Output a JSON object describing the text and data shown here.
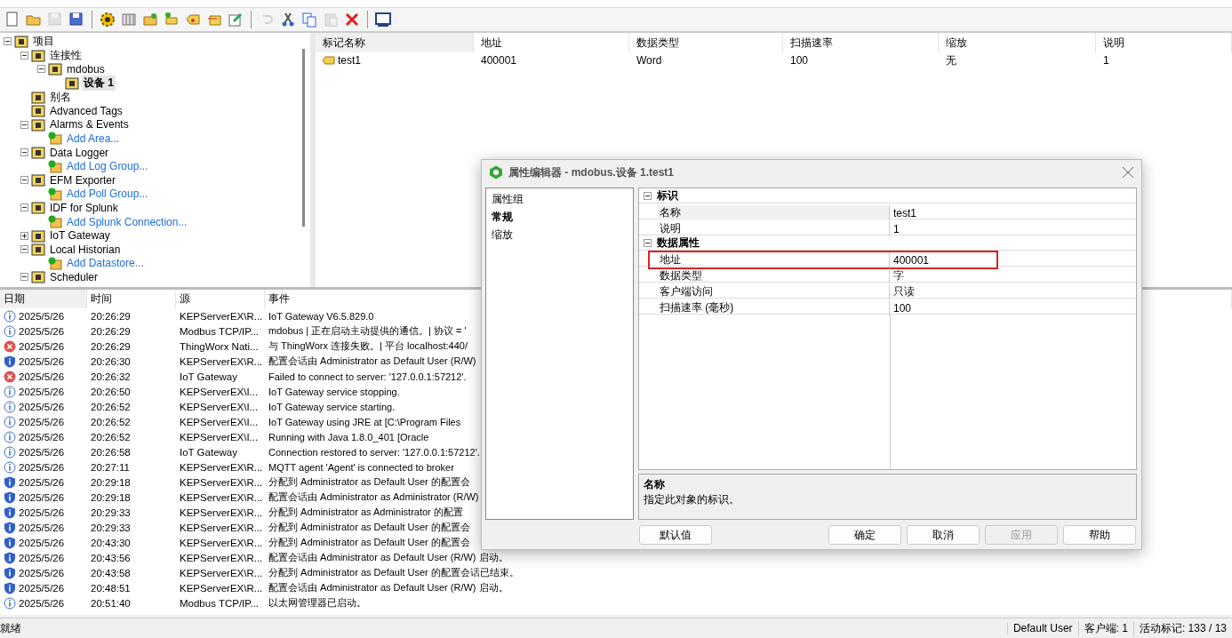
{
  "toolbar": {
    "buttons": [
      {
        "kind": "new"
      },
      {
        "kind": "open"
      },
      {
        "kind": "save",
        "disabled": true
      },
      {
        "kind": "saveas"
      },
      {
        "kind": "sep"
      },
      {
        "kind": "gear"
      },
      {
        "kind": "grid"
      },
      {
        "kind": "folderadd"
      },
      {
        "kind": "tagadd"
      },
      {
        "kind": "tag"
      },
      {
        "kind": "tags"
      },
      {
        "kind": "edit"
      },
      {
        "kind": "sep"
      },
      {
        "kind": "undo",
        "disabled": true
      },
      {
        "kind": "cut"
      },
      {
        "kind": "copy"
      },
      {
        "kind": "paste",
        "disabled": true
      },
      {
        "kind": "delete"
      },
      {
        "kind": "sep"
      },
      {
        "kind": "monitor"
      }
    ]
  },
  "tree": [
    {
      "label": "项目",
      "kind": "node",
      "expanded": true,
      "selected": false,
      "children": [
        {
          "label": "连接性",
          "kind": "node",
          "expanded": true,
          "selected": false,
          "children": [
            {
              "label": "mdobus",
              "kind": "node",
              "expanded": true,
              "selected": false,
              "children": [
                {
                  "label": "设备 1",
                  "kind": "node",
                  "selected": true
                }
              ]
            }
          ]
        },
        {
          "label": "别名",
          "kind": "node",
          "selected": false
        },
        {
          "label": "Advanced Tags",
          "kind": "node",
          "selected": false
        },
        {
          "label": "Alarms & Events",
          "kind": "node",
          "expanded": true,
          "selected": false,
          "children": [
            {
              "label": "Add Area...",
              "kind": "action",
              "selected": false
            }
          ]
        },
        {
          "label": "Data Logger",
          "kind": "node",
          "expanded": true,
          "selected": false,
          "children": [
            {
              "label": "Add Log Group...",
              "kind": "action",
              "selected": false
            }
          ]
        },
        {
          "label": "EFM Exporter",
          "kind": "node",
          "expanded": true,
          "selected": false,
          "children": [
            {
              "label": "Add Poll Group...",
              "kind": "action",
              "selected": false
            }
          ]
        },
        {
          "label": "IDF for Splunk",
          "kind": "node",
          "expanded": true,
          "selected": false,
          "children": [
            {
              "label": "Add Splunk Connection...",
              "kind": "action",
              "selected": false
            }
          ]
        },
        {
          "label": "IoT Gateway",
          "kind": "node",
          "expanded": false,
          "selected": false
        },
        {
          "label": "Local Historian",
          "kind": "node",
          "expanded": true,
          "selected": false,
          "children": [
            {
              "label": "Add Datastore...",
              "kind": "action",
              "selected": false
            }
          ]
        },
        {
          "label": "Scheduler",
          "kind": "node",
          "expanded": true,
          "selected": false
        }
      ]
    }
  ],
  "tag_table": {
    "columns": [
      "标记名称",
      "地址",
      "数据类型",
      "扫描速率",
      "缩放",
      "说明"
    ],
    "rows": [
      [
        "test1",
        "400001",
        "Word",
        "100",
        "无",
        "1"
      ]
    ]
  },
  "event_log": {
    "columns": [
      "日期",
      "时间",
      "源",
      "事件"
    ],
    "rows": [
      {
        "kind": "info",
        "date": "2025/5/26",
        "time": "20:26:29",
        "source": "KEPServerEX\\R...",
        "event": "IoT Gateway V6.5.829.0"
      },
      {
        "kind": "info",
        "date": "2025/5/26",
        "time": "20:26:29",
        "source": "Modbus TCP/IP...",
        "event": "mdobus | 正在启动主动提供的通信。| 协议 = '"
      },
      {
        "kind": "error",
        "date": "2025/5/26",
        "time": "20:26:29",
        "source": "ThingWorx Nati...",
        "event": "与 ThingWorx 连接失败。| 平台 localhost:440/"
      },
      {
        "kind": "security",
        "date": "2025/5/26",
        "time": "20:26:30",
        "source": "KEPServerEX\\R...",
        "event": "配置会话由 Administrator as Default User (R/W)"
      },
      {
        "kind": "error",
        "date": "2025/5/26",
        "time": "20:26:32",
        "source": "IoT Gateway",
        "event": "Failed to connect to server: '127.0.0.1:57212'."
      },
      {
        "kind": "info",
        "date": "2025/5/26",
        "time": "20:26:50",
        "source": "KEPServerEX\\I...",
        "event": "IoT Gateway service stopping."
      },
      {
        "kind": "info",
        "date": "2025/5/26",
        "time": "20:26:52",
        "source": "KEPServerEX\\I...",
        "event": "IoT Gateway service starting."
      },
      {
        "kind": "info",
        "date": "2025/5/26",
        "time": "20:26:52",
        "source": "KEPServerEX\\I...",
        "event": "IoT Gateway using JRE at [C:\\Program Files"
      },
      {
        "kind": "info",
        "date": "2025/5/26",
        "time": "20:26:52",
        "source": "KEPServerEX\\I...",
        "event": "Running with Java 1.8.0_401 [Oracle"
      },
      {
        "kind": "info",
        "date": "2025/5/26",
        "time": "20:26:58",
        "source": "IoT Gateway",
        "event": "Connection restored to server: '127.0.0.1:57212'."
      },
      {
        "kind": "info",
        "date": "2025/5/26",
        "time": "20:27:11",
        "source": "KEPServerEX\\R...",
        "event": "MQTT agent 'Agent' is connected to broker"
      },
      {
        "kind": "security",
        "date": "2025/5/26",
        "time": "20:29:18",
        "source": "KEPServerEX\\R...",
        "event": "分配到 Administrator as Default User 的配置会"
      },
      {
        "kind": "security",
        "date": "2025/5/26",
        "time": "20:29:18",
        "source": "KEPServerEX\\R...",
        "event": "配置会话由 Administrator as Administrator (R/W)"
      },
      {
        "kind": "security",
        "date": "2025/5/26",
        "time": "20:29:33",
        "source": "KEPServerEX\\R...",
        "event": "分配到 Administrator as Administrator 的配置"
      },
      {
        "kind": "security",
        "date": "2025/5/26",
        "time": "20:29:33",
        "source": "KEPServerEX\\R...",
        "event": "分配到 Administrator as Default User 的配置会"
      },
      {
        "kind": "security",
        "date": "2025/5/26",
        "time": "20:43:30",
        "source": "KEPServerEX\\R...",
        "event": "分配到 Administrator as Default User 的配置会"
      },
      {
        "kind": "security",
        "date": "2025/5/26",
        "time": "20:43:56",
        "source": "KEPServerEX\\R...",
        "event": "配置会话由 Administrator as Default User (R/W) 启动。"
      },
      {
        "kind": "security",
        "date": "2025/5/26",
        "time": "20:43:58",
        "source": "KEPServerEX\\R...",
        "event": "分配到 Administrator as Default User 的配置会话已结束。"
      },
      {
        "kind": "security",
        "date": "2025/5/26",
        "time": "20:48:51",
        "source": "KEPServerEX\\R...",
        "event": "配置会话由 Administrator as Default User (R/W) 启动。"
      },
      {
        "kind": "info",
        "date": "2025/5/26",
        "time": "20:51:40",
        "source": "Modbus TCP/IP...",
        "event": "以太网管理器已启动。"
      }
    ]
  },
  "status_bar": {
    "state": "就绪",
    "user": "Default User",
    "clients": "客户端: 1",
    "active_tags": "活动标记: 133 / 13"
  },
  "dialog": {
    "title": "属性编辑器 - mdobus.设备 1.test1",
    "groups_header": "属性组",
    "groups": [
      {
        "label": "常规",
        "selected": true
      },
      {
        "label": "缩放",
        "selected": false
      }
    ],
    "sections": [
      {
        "title": "标识",
        "expanded": true,
        "properties": [
          {
            "name": "名称",
            "value": "test1",
            "selected": true,
            "highlighted": false
          },
          {
            "name": "说明",
            "value": "1",
            "selected": false,
            "highlighted": false
          }
        ]
      },
      {
        "title": "数据属性",
        "expanded": true,
        "properties": [
          {
            "name": "地址",
            "value": "400001",
            "selected": false,
            "highlighted": true
          },
          {
            "name": "数据类型",
            "value": "字",
            "selected": false,
            "highlighted": false
          },
          {
            "name": "客户端访问",
            "value": "只读",
            "selected": false,
            "highlighted": false
          },
          {
            "name": "扫描速率 (毫秒)",
            "value": "100",
            "selected": false,
            "highlighted": false
          }
        ]
      }
    ],
    "help": {
      "title": "名称",
      "text": "指定此对象的标识。"
    },
    "buttons": [
      {
        "label": "默认值",
        "disabled": false
      },
      {
        "label": "确定",
        "disabled": false
      },
      {
        "label": "取消",
        "disabled": false
      },
      {
        "label": "应用",
        "disabled": true
      },
      {
        "label": "帮助",
        "disabled": false
      }
    ]
  }
}
